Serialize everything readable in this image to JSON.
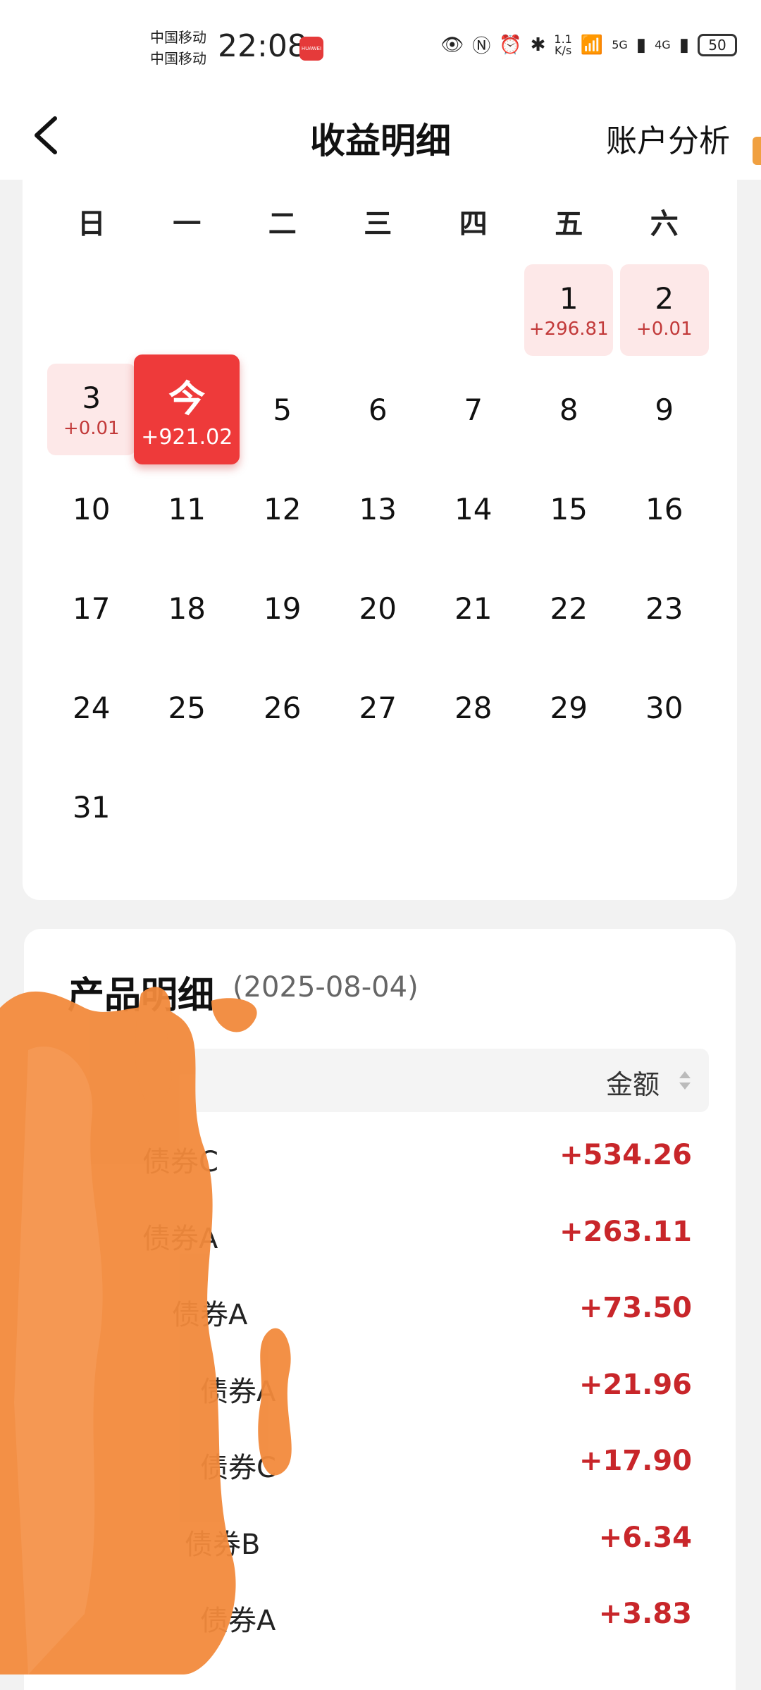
{
  "status_bar": {
    "carrier_1": "中国移动",
    "carrier_2": "中国移动",
    "time": "22:08",
    "badge": "HUAWEI",
    "net_speed_value": "1.1",
    "net_speed_unit": "K/s",
    "signal_1": "5G",
    "signal_2": "4G",
    "battery": "50"
  },
  "header": {
    "title": "收益明细",
    "right_action": "账户分析"
  },
  "calendar": {
    "weekdays": [
      "日",
      "一",
      "二",
      "三",
      "四",
      "五",
      "六"
    ],
    "today_label": "今",
    "days": [
      {
        "day": "1",
        "amount": "+296.81",
        "state": "gain"
      },
      {
        "day": "2",
        "amount": "+0.01",
        "state": "gain"
      },
      {
        "day": "3",
        "amount": "+0.01",
        "state": "gain"
      },
      {
        "day": "今",
        "amount": "+921.02",
        "state": "today"
      },
      {
        "day": "5",
        "amount": "",
        "state": "none"
      },
      {
        "day": "6",
        "amount": "",
        "state": "none"
      },
      {
        "day": "7",
        "amount": "",
        "state": "none"
      },
      {
        "day": "8",
        "amount": "",
        "state": "none"
      },
      {
        "day": "9",
        "amount": "",
        "state": "none"
      },
      {
        "day": "10",
        "amount": "",
        "state": "none"
      },
      {
        "day": "11",
        "amount": "",
        "state": "none"
      },
      {
        "day": "12",
        "amount": "",
        "state": "none"
      },
      {
        "day": "13",
        "amount": "",
        "state": "none"
      },
      {
        "day": "14",
        "amount": "",
        "state": "none"
      },
      {
        "day": "15",
        "amount": "",
        "state": "none"
      },
      {
        "day": "16",
        "amount": "",
        "state": "none"
      },
      {
        "day": "17",
        "amount": "",
        "state": "none"
      },
      {
        "day": "18",
        "amount": "",
        "state": "none"
      },
      {
        "day": "19",
        "amount": "",
        "state": "none"
      },
      {
        "day": "20",
        "amount": "",
        "state": "none"
      },
      {
        "day": "21",
        "amount": "",
        "state": "none"
      },
      {
        "day": "22",
        "amount": "",
        "state": "none"
      },
      {
        "day": "23",
        "amount": "",
        "state": "none"
      },
      {
        "day": "24",
        "amount": "",
        "state": "none"
      },
      {
        "day": "25",
        "amount": "",
        "state": "none"
      },
      {
        "day": "26",
        "amount": "",
        "state": "none"
      },
      {
        "day": "27",
        "amount": "",
        "state": "none"
      },
      {
        "day": "28",
        "amount": "",
        "state": "none"
      },
      {
        "day": "29",
        "amount": "",
        "state": "none"
      },
      {
        "day": "30",
        "amount": "",
        "state": "none"
      },
      {
        "day": "31",
        "amount": "",
        "state": "none"
      }
    ]
  },
  "products": {
    "title": "产品明细",
    "date": "(2025-08-04)",
    "amount_header": "金额",
    "rows": [
      {
        "name": "债券C",
        "amount": "+534.26"
      },
      {
        "name": "债券A",
        "amount": "+263.11"
      },
      {
        "name": "债券A",
        "amount": "+73.50"
      },
      {
        "name": "债券A",
        "amount": "+21.96"
      },
      {
        "name": "债券C",
        "amount": "+17.90"
      },
      {
        "name": "债券B",
        "amount": "+6.34"
      },
      {
        "name": "债券A",
        "amount": "+3.83"
      }
    ]
  },
  "colors": {
    "accent_red": "#ee3a3a",
    "gain_bg": "#fde8e8",
    "value_red": "#c8262a",
    "redaction_orange": "#f28a3c"
  }
}
